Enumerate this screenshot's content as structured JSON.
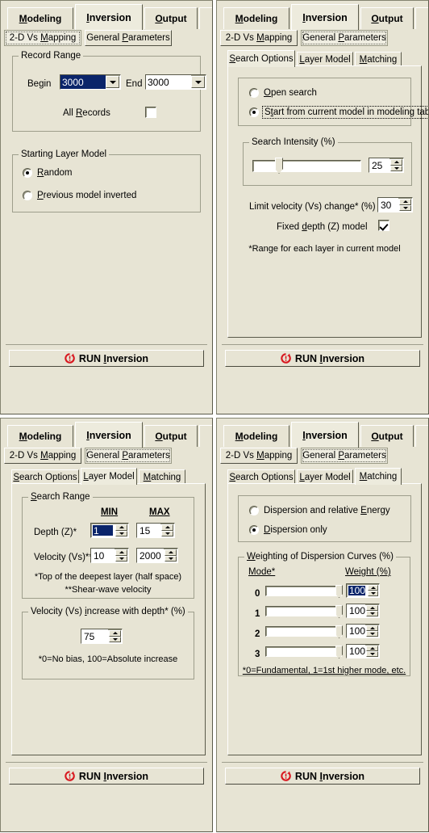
{
  "main_tabs": [
    {
      "label": "Modeling",
      "accel": "M",
      "active": false
    },
    {
      "label": "Inversion",
      "accel": "I",
      "active": true
    },
    {
      "label": "Output",
      "accel": "O",
      "active": false
    }
  ],
  "sub_tabs": [
    {
      "label": "2-D Vs Mapping",
      "accel": "M"
    },
    {
      "label": "General Parameters",
      "accel": "P"
    }
  ],
  "inner_tabs": [
    {
      "label": "Search Options",
      "accel": "S"
    },
    {
      "label": "Layer Model",
      "accel": "L"
    },
    {
      "label": "Matching",
      "accel": "M"
    }
  ],
  "run_button": {
    "label": "RUN Inversion",
    "accel": "I",
    "icon": "run-inversion-icon",
    "icon_color": "#D81820"
  },
  "panel_tl": {
    "selected_sub_tab": "2-D Vs Mapping",
    "record_range": {
      "title": "Record Range",
      "begin_label": "Begin",
      "begin_value": "3000",
      "end_label": "End",
      "end_value": "3000",
      "all_records_label": "All Records",
      "all_records_checked": false
    },
    "starting_layer_model": {
      "title": "Starting Layer Model",
      "options": [
        {
          "label": "Random",
          "accel": "R",
          "selected": true
        },
        {
          "label": "Previous model inverted",
          "accel": "P",
          "selected": false
        }
      ]
    }
  },
  "panel_tr": {
    "selected_sub_tab": "General Parameters",
    "selected_inner_tab": "Search Options",
    "search_mode": {
      "options": [
        {
          "label": "Open search",
          "accel": "O",
          "selected": false,
          "focused": false
        },
        {
          "label": "Start from current model in modeling tab",
          "accel": "t",
          "selected": true,
          "focused": true
        }
      ]
    },
    "search_intensity": {
      "title": "Search Intensity (%)",
      "value": "25",
      "slider_percent": 25
    },
    "limit_velocity": {
      "label": "Limit velocity (Vs) change* (%)",
      "value": "30"
    },
    "fixed_depth": {
      "label": "Fixed depth (Z) model",
      "accel": "d",
      "checked": true
    },
    "footnote": "*Range for each layer in current model"
  },
  "panel_bl": {
    "selected_sub_tab": "General Parameters",
    "selected_inner_tab": "Layer Model",
    "search_range": {
      "title": "Search Range",
      "col_min": "MIN",
      "col_max": "MAX",
      "rows": [
        {
          "label": "Depth (Z)*",
          "min": "1",
          "max": "15",
          "min_selected": true
        },
        {
          "label": "Velocity (Vs)**",
          "min": "10",
          "max": "2000",
          "min_selected": false
        }
      ],
      "footnote1": "*Top of the deepest layer (half space)",
      "footnote2": "**Shear-wave velocity"
    },
    "velocity_increase": {
      "title": "Velocity (Vs) increase with depth* (%)",
      "value": "75",
      "footnote": "*0=No bias, 100=Absolute increase"
    }
  },
  "panel_br": {
    "selected_sub_tab": "General Parameters",
    "selected_inner_tab": "Matching",
    "matching_mode": {
      "options": [
        {
          "label": "Dispersion and relative Energy",
          "accel": "E",
          "selected": false
        },
        {
          "label": "Dispersion only",
          "accel": "D",
          "selected": true
        }
      ]
    },
    "weighting": {
      "title": "Weighting of Dispersion Curves (%)",
      "col_mode": "Mode*",
      "col_weight": "Weight (%)",
      "rows": [
        {
          "mode": "0",
          "weight": "100",
          "slider_percent": 100,
          "selected": true
        },
        {
          "mode": "1",
          "weight": "100",
          "slider_percent": 100,
          "selected": false
        },
        {
          "mode": "2",
          "weight": "100",
          "slider_percent": 100,
          "selected": false
        },
        {
          "mode": "3",
          "weight": "100",
          "slider_percent": 100,
          "selected": false
        }
      ],
      "footnote": "*0=Fundamental, 1=1st higher mode, etc."
    }
  }
}
